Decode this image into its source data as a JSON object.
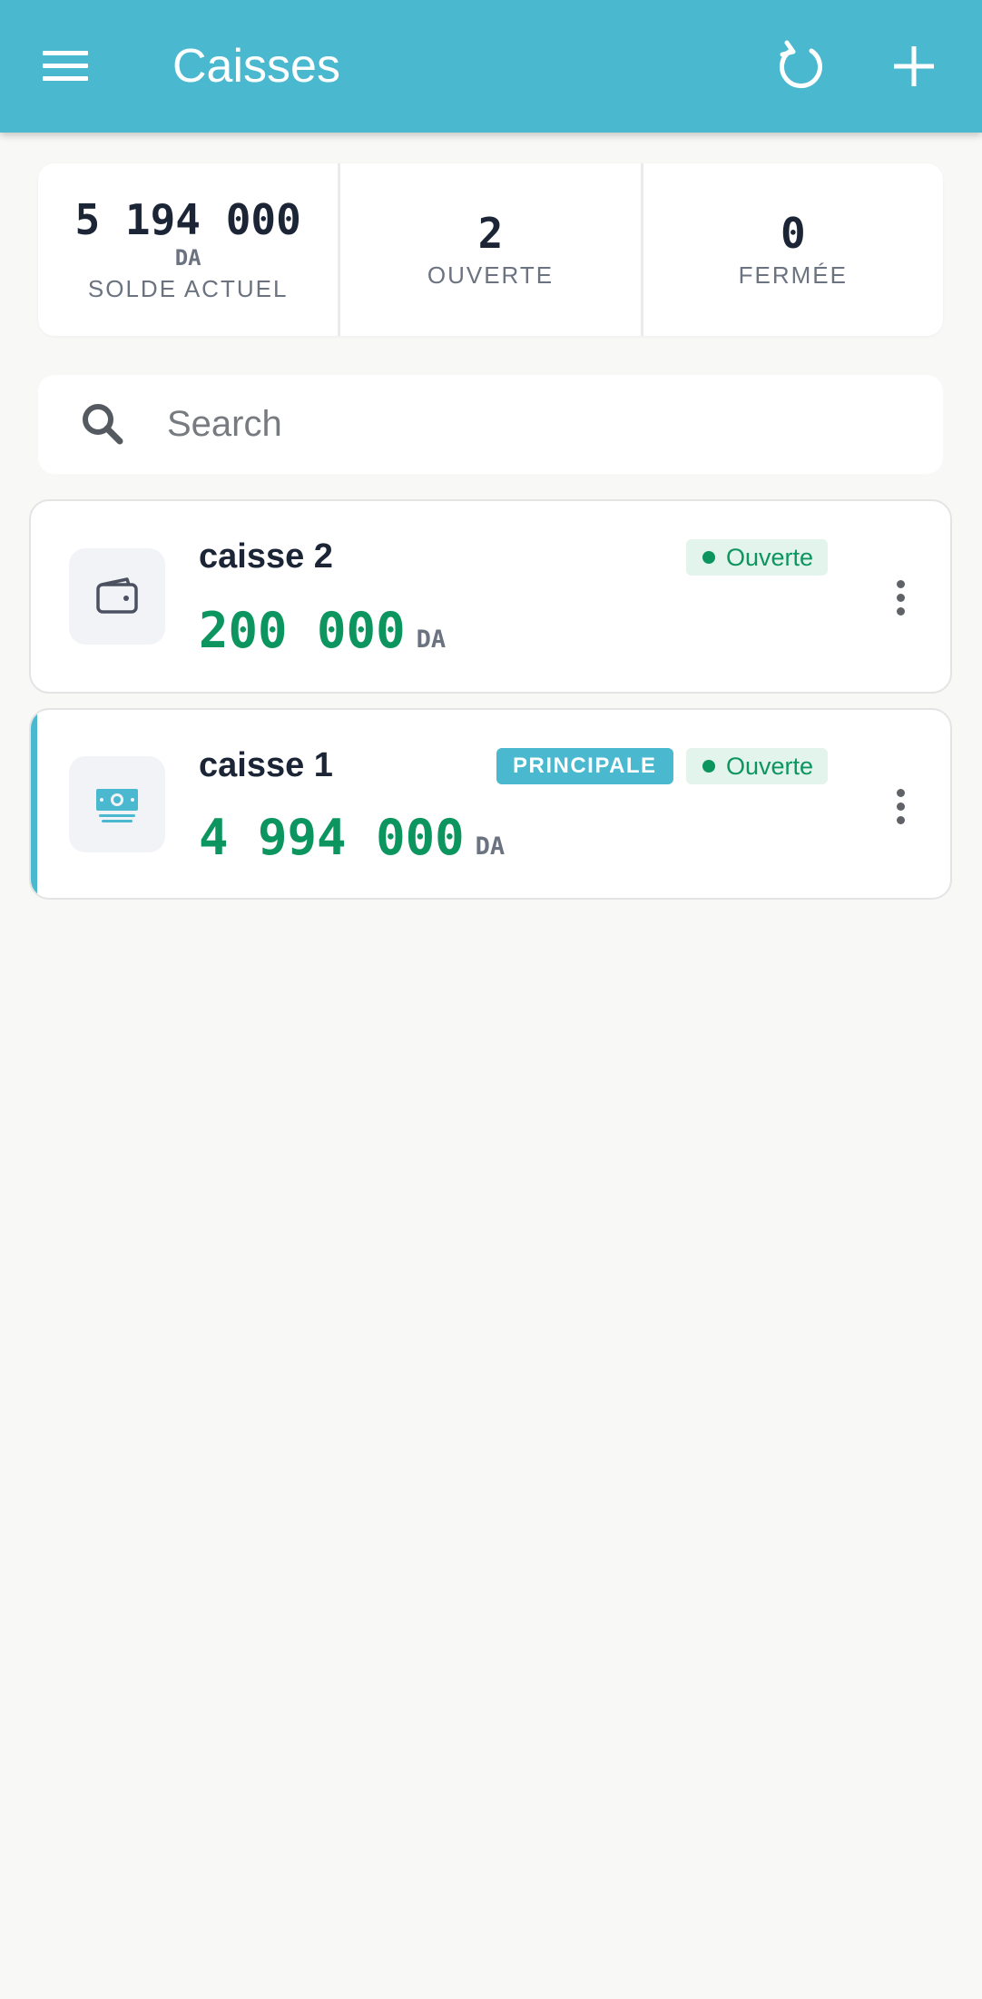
{
  "appbar": {
    "title": "Caisses",
    "menu_icon": "menu-icon",
    "refresh_icon": "refresh-icon",
    "add_icon": "plus-icon",
    "color": "#4ab8cf"
  },
  "stats": [
    {
      "value": "5 194 000",
      "unit": "DA",
      "label": "SOLDE ACTUEL"
    },
    {
      "value": "2",
      "label": "OUVERTE"
    },
    {
      "value": "0",
      "label": "FERMÉE"
    }
  ],
  "search": {
    "placeholder": "Search",
    "value": "",
    "icon": "search-icon"
  },
  "caisses": [
    {
      "name": "caisse 2",
      "amount": "200 000",
      "currency": "DA",
      "status": "Ouverte",
      "icon": "wallet-icon",
      "principal": false
    },
    {
      "name": "caisse 1",
      "amount": "4 994 000",
      "currency": "DA",
      "status": "Ouverte",
      "badge": "PRINCIPALE",
      "icon": "banknote-icon",
      "principal": true
    }
  ],
  "colors": {
    "accent": "#4ab8cf",
    "amount": "#0d955f",
    "status_bg": "#e3f4ec"
  }
}
